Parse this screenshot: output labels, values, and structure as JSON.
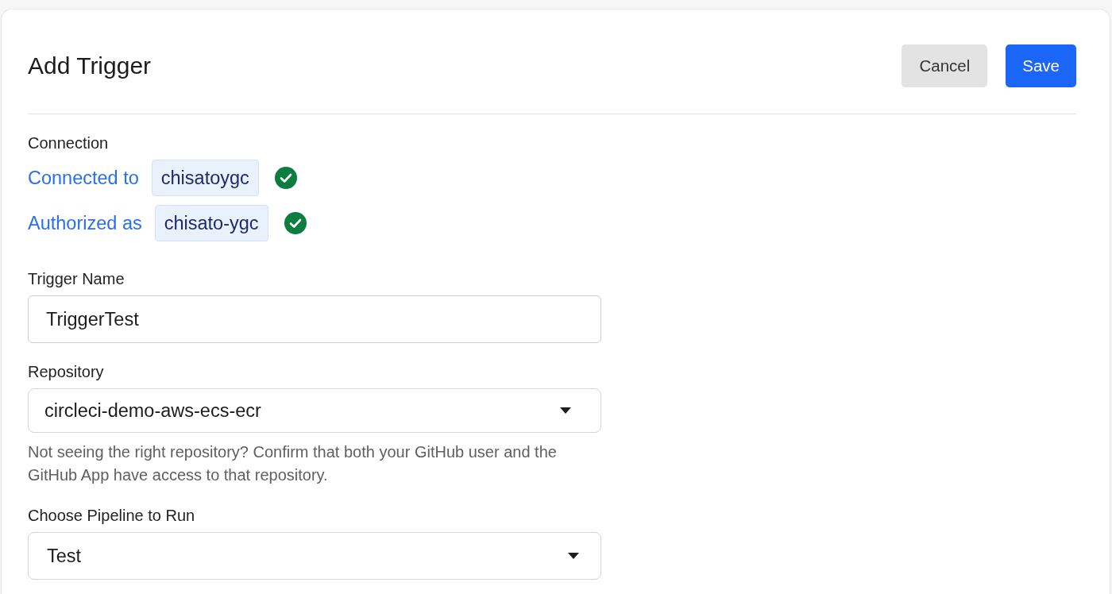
{
  "header": {
    "title": "Add Trigger",
    "buttons": [
      {
        "label": "Cancel",
        "kind": "secondary"
      },
      {
        "label": "Save",
        "kind": "primary"
      }
    ]
  },
  "connection": {
    "label": "Connection",
    "items": [
      {
        "label": "Connected to",
        "value": "chisatoygc",
        "verified": true
      },
      {
        "label": "Authorized as",
        "value": "chisato-ygc",
        "verified": true
      }
    ]
  },
  "fields": [
    {
      "kind": "text",
      "label": "Trigger Name",
      "value": "TriggerTest"
    },
    {
      "kind": "select",
      "label": "Repository",
      "value": "circleci-demo-aws-ecs-ecr",
      "help": "Not seeing the right repository? Confirm that both your GitHub user and the GitHub App have access to that repository."
    },
    {
      "kind": "select",
      "label": "Choose Pipeline to Run",
      "value": "Test"
    }
  ]
}
